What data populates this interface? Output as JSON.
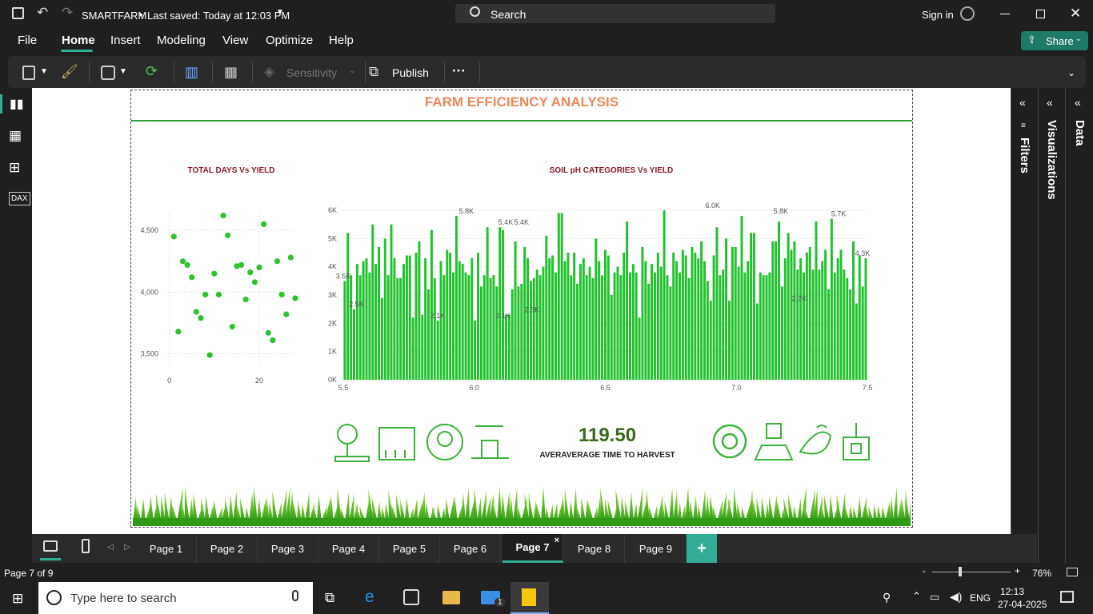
{
  "titlebar": {
    "app_title": "SMARTFARM",
    "saved_status": "Last saved: Today at 12:03 PM",
    "search_label": "Search",
    "signin_label": "Sign in"
  },
  "menu": {
    "items": [
      "File",
      "Home",
      "Insert",
      "Modeling",
      "View",
      "Optimize",
      "Help"
    ],
    "active": "Home",
    "share_label": "Share"
  },
  "ribbon": {
    "sensitivity_label": "Sensitivity",
    "publish_label": "Publish",
    "more_label": "···"
  },
  "report": {
    "title": "FARM EFFICIENCY ANALYSIS",
    "kpi_value": "119.50",
    "kpi_label": "AVERAVERAGE TIME TO HARVEST",
    "colors": {
      "title": "#f0875a",
      "rule": "#2e9e3a",
      "bar": "#22c22e",
      "kpi": "#3a6b1a",
      "chart_title": "#8b1a2b"
    }
  },
  "chart_data": [
    {
      "type": "scatter",
      "title": "TOTAL DAYS Vs YIELD",
      "xticks": [
        "0",
        "20"
      ],
      "yticks": [
        "3,500",
        "4,000",
        "4,500"
      ],
      "xlim": [
        -1,
        28
      ],
      "ylim": [
        3400,
        4650
      ],
      "points": [
        [
          1,
          4450
        ],
        [
          2,
          3680
        ],
        [
          3,
          4250
        ],
        [
          4,
          4220
        ],
        [
          5,
          4120
        ],
        [
          6,
          3840
        ],
        [
          7,
          3790
        ],
        [
          8,
          3980
        ],
        [
          9,
          3490
        ],
        [
          10,
          4150
        ],
        [
          11,
          3980
        ],
        [
          12,
          4620
        ],
        [
          13,
          4460
        ],
        [
          14,
          3720
        ],
        [
          15,
          4210
        ],
        [
          16,
          4220
        ],
        [
          17,
          3940
        ],
        [
          18,
          4160
        ],
        [
          19,
          4080
        ],
        [
          20,
          4200
        ],
        [
          21,
          4550
        ],
        [
          22,
          3670
        ],
        [
          23,
          3610
        ],
        [
          24,
          4250
        ],
        [
          25,
          3980
        ],
        [
          26,
          3820
        ],
        [
          27,
          4280
        ],
        [
          28,
          3950
        ]
      ]
    },
    {
      "type": "bar",
      "title": "SOIL pH CATEGORIES Vs YIELD",
      "xticks": [
        "5.5",
        "6.0",
        "6.5",
        "7.0",
        "7.5"
      ],
      "yticks": [
        "0K",
        "1K",
        "2K",
        "3K",
        "4K",
        "5K",
        "6K"
      ],
      "xlim": [
        5.5,
        7.5
      ],
      "ylim": [
        0,
        6000
      ],
      "data_labels": [
        {
          "x": 5.5,
          "text": "3.5K"
        },
        {
          "x": 5.55,
          "text": "2.5K"
        },
        {
          "x": 5.97,
          "text": "5.8K"
        },
        {
          "x": 5.86,
          "text": "2.1K"
        },
        {
          "x": 6.11,
          "text": "2.1K"
        },
        {
          "x": 6.12,
          "text": "5.4K"
        },
        {
          "x": 6.18,
          "text": "5.4K"
        },
        {
          "x": 6.22,
          "text": "2.3K"
        },
        {
          "x": 6.91,
          "text": "6.0K"
        },
        {
          "x": 7.17,
          "text": "5.8K"
        },
        {
          "x": 7.24,
          "text": "2.7K"
        },
        {
          "x": 7.39,
          "text": "5.7K"
        },
        {
          "x": 7.5,
          "text": "4.3K"
        }
      ],
      "values": [
        3500,
        5200,
        3700,
        2500,
        4100,
        3700,
        4200,
        4300,
        3800,
        5500,
        4100,
        4700,
        2900,
        5000,
        3700,
        5500,
        4300,
        3600,
        3600,
        4100,
        4400,
        4400,
        2200,
        4500,
        4900,
        2300,
        4300,
        3200,
        5300,
        3600,
        2100,
        4200,
        3700,
        4600,
        4500,
        3800,
        5800,
        4200,
        4100,
        3800,
        3700,
        4300,
        2100,
        4500,
        3300,
        3700,
        5400,
        3600,
        3700,
        3300,
        5400,
        5300,
        2300,
        2300,
        3200,
        4900,
        3300,
        3400,
        4700,
        4300,
        3500,
        3600,
        3900,
        3700,
        4000,
        5100,
        4300,
        4400,
        3800,
        5900,
        5900,
        4200,
        4500,
        3700,
        4500,
        3400,
        4100,
        4300,
        3700,
        4000,
        3600,
        5000,
        4200,
        3700,
        4600,
        4400,
        3000,
        3800,
        4000,
        3700,
        4500,
        5600,
        3800,
        4100,
        3800,
        2200,
        4700,
        4200,
        3400,
        4100,
        3800,
        4500,
        4000,
        6000,
        3700,
        3300,
        4500,
        4200,
        3800,
        4600,
        4400,
        3600,
        4700,
        4500,
        4300,
        4900,
        4200,
        3500,
        2800,
        4400,
        5400,
        3700,
        3900,
        5000,
        2800,
        4700,
        4700,
        4000,
        5800,
        3800,
        4200,
        5200,
        5200,
        2700,
        3800,
        3700,
        3700,
        3800,
        4900,
        4900,
        5600,
        3300,
        4300,
        5200,
        4600,
        4900,
        3900,
        4300,
        3800,
        4500,
        4700,
        3900,
        5600,
        3900,
        4200,
        4600,
        3200,
        5700,
        3800,
        4300,
        4600,
        3900,
        3600,
        3200,
        4900,
        2700,
        4400,
        3300,
        4300
      ]
    }
  ],
  "page_tabs": [
    "Page 1",
    "Page 2",
    "Page 3",
    "Page 4",
    "Page 5",
    "Page 6",
    "Page 7",
    "Page 8",
    "Page 9"
  ],
  "active_page": "Page 7",
  "right_panes": {
    "filters": "Filters",
    "visualizations": "Visualizations",
    "data": "Data"
  },
  "status": {
    "page_info": "Page 7 of 9",
    "zoom": "76%"
  },
  "taskbar": {
    "search_placeholder": "Type here to search",
    "lang": "ENG",
    "time": "12:13",
    "date": "27-04-2025",
    "mail_badge": "1"
  }
}
